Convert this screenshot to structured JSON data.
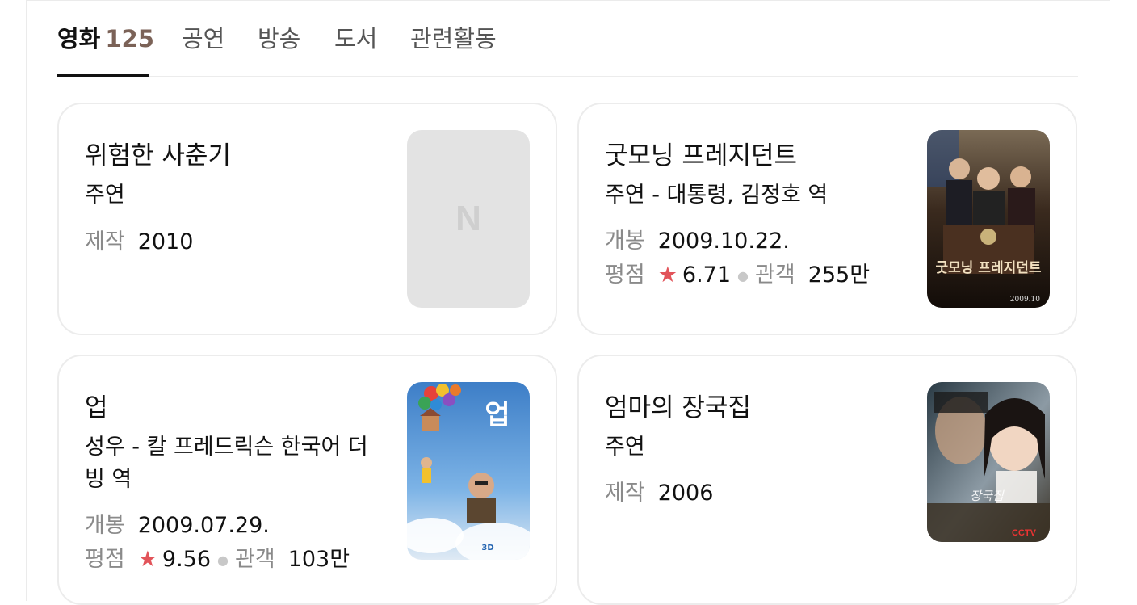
{
  "tabs": [
    {
      "label": "영화",
      "count": "125",
      "active": true
    },
    {
      "label": "공연"
    },
    {
      "label": "방송"
    },
    {
      "label": "도서"
    },
    {
      "label": "관련활동"
    }
  ],
  "cards": [
    {
      "title": "위험한 사춘기",
      "role": "주연",
      "meta1": {
        "key": "제작",
        "value": "2010"
      },
      "poster": "placeholder",
      "placeholder_icon": "N"
    },
    {
      "title": "굿모닝 프레지던트",
      "role": "주연 - 대통령, 김정호 역",
      "meta1": {
        "key": "개봉",
        "value": "2009.10.22."
      },
      "meta2": {
        "rating_key": "평점",
        "rating": "6.71",
        "audience_key": "관객",
        "audience": "255만"
      },
      "poster_text": "굿모닝 프레지던트",
      "poster_date": "2009.10"
    },
    {
      "title": "업",
      "role": "성우 - 칼 프레드릭슨 한국어 더빙 역",
      "meta1": {
        "key": "개봉",
        "value": "2009.07.29."
      },
      "meta2": {
        "rating_key": "평점",
        "rating": "9.56",
        "audience_key": "관객",
        "audience": "103만"
      },
      "poster_text": "업",
      "poster_tag": "3D"
    },
    {
      "title": "엄마의 장국집",
      "role": "주연",
      "meta1": {
        "key": "제작",
        "value": "2006"
      },
      "poster_tag": "CCTV"
    }
  ],
  "colors": {
    "accent_count": "#7b6257",
    "star": "#e2545a",
    "meta_key": "#8a8a8a"
  }
}
